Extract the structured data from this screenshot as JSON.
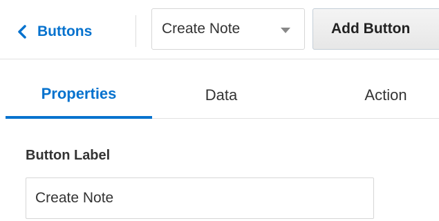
{
  "header": {
    "back_label": "Buttons",
    "back_icon": "chevron-left-icon",
    "dropdown": {
      "selected": "Create Note",
      "icon": "caret-down-icon"
    },
    "add_button_label": "Add Button"
  },
  "tabs": [
    {
      "label": "Properties",
      "active": true
    },
    {
      "label": "Data",
      "active": false
    },
    {
      "label": "Action",
      "active": false
    }
  ],
  "form": {
    "button_label": {
      "label": "Button Label",
      "value": "Create Note"
    }
  },
  "colors": {
    "accent": "#0572ce",
    "text": "#333333",
    "border": "#d6d6d6"
  }
}
